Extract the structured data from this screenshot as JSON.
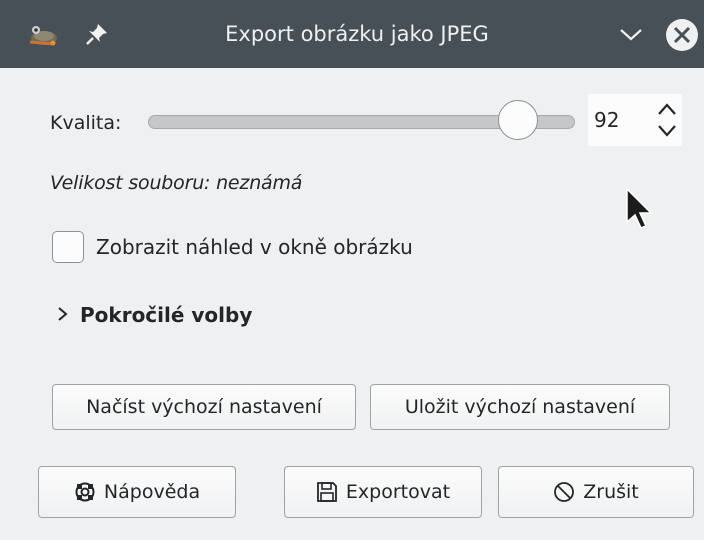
{
  "window": {
    "title": "Export obrázku jako JPEG",
    "icons": [
      "gimp-app-icon",
      "pin-icon",
      "chevron-down-icon",
      "close-icon"
    ]
  },
  "quality": {
    "label": "Kvalita:",
    "value": "92",
    "slider_fraction": 0.92
  },
  "file_size": {
    "text": "Velikost souboru: neznámá"
  },
  "preview": {
    "label": "Zobrazit náhled v okně obrázku",
    "checked": false
  },
  "advanced": {
    "label": "Pokročilé volby",
    "expanded": false
  },
  "defaults": {
    "load_label": "Načíst výchozí nastavení",
    "save_label": "Uložit výchozí nastavení"
  },
  "actions": {
    "help_label": "Nápověda",
    "export_label": "Exportovat",
    "cancel_label": "Zrušit"
  },
  "colors": {
    "titlebar": "#475057",
    "background": "#eff0f1"
  }
}
